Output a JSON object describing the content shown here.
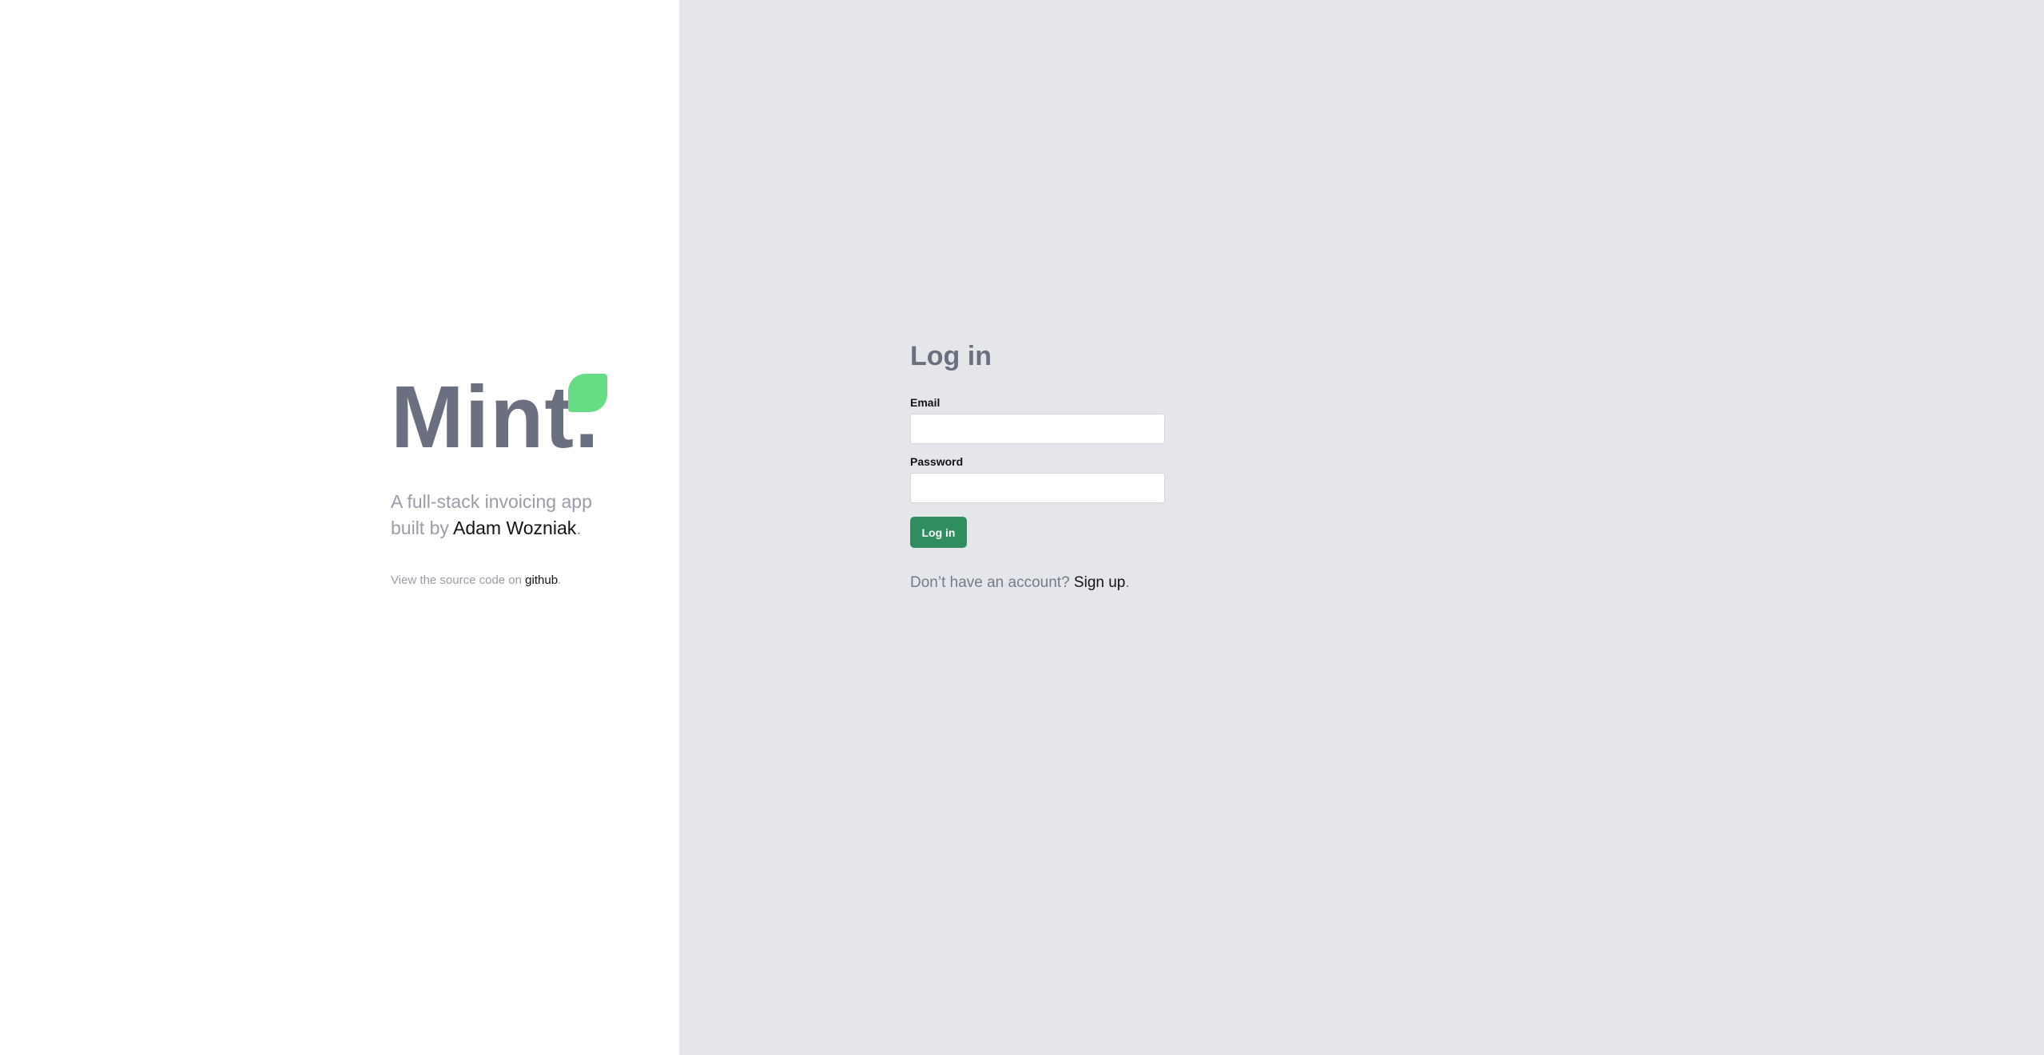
{
  "brand": {
    "wordmark": "Mint.",
    "leaf_icon": "leaf-icon",
    "leaf_color": "#66dd84"
  },
  "tagline": {
    "prefix": "A full-stack invoicing app built by ",
    "author": "Adam Wozniak",
    "suffix": "."
  },
  "source": {
    "prefix": "View the source code on ",
    "link": "github",
    "suffix": "."
  },
  "login": {
    "title": "Log in",
    "email_label": "Email",
    "email_value": "",
    "password_label": "Password",
    "password_value": "",
    "submit_label": "Log in",
    "signup_prefix": "Don’t have an account? ",
    "signup_link": "Sign up",
    "signup_suffix": "."
  },
  "colors": {
    "left_background": "#ffffff",
    "right_background": "#e5e6ea",
    "primary_button": "#2f8d5f",
    "heading": "#6b7080"
  }
}
